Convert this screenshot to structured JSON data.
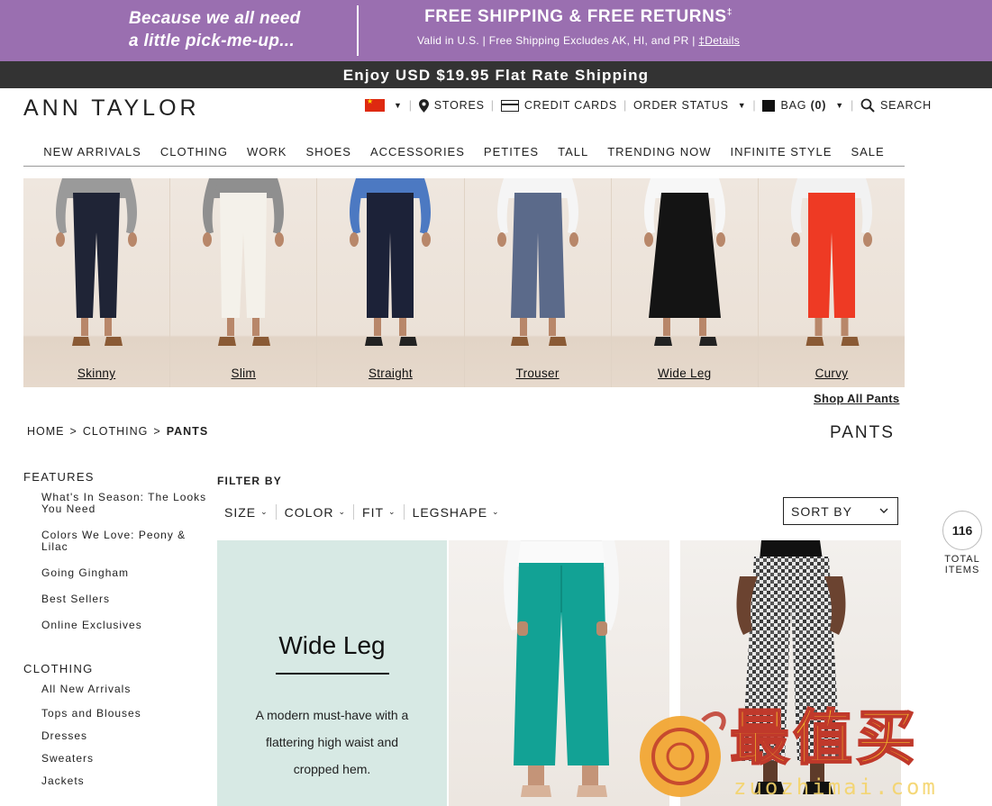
{
  "promo": {
    "left_line1": "Because we all need",
    "left_line2": "a little pick-me-up...",
    "headline": "FREE SHIPPING & FREE RETURNS",
    "headline_mark": "‡",
    "sub": "Valid in U.S. | Free Shipping Excludes AK, HI, and PR |",
    "details_link": "‡Details"
  },
  "shipbar": {
    "text": "Enjoy USD $19.95 Flat Rate Shipping"
  },
  "header": {
    "logo": "ANN TAYLOR",
    "stores": "STORES",
    "credit_cards": "CREDIT CARDS",
    "order_status": "ORDER STATUS",
    "bag": "BAG",
    "bag_count": "(0)",
    "search": "SEARCH"
  },
  "nav": {
    "items": [
      "NEW ARRIVALS",
      "CLOTHING",
      "WORK",
      "SHOES",
      "ACCESSORIES",
      "PETITES",
      "TALL",
      "TRENDING NOW",
      "INFINITE STYLE",
      "SALE"
    ]
  },
  "hero": {
    "tiles": [
      {
        "label": "Skinny",
        "pant": "#1f2436",
        "top": "#9a9a9a",
        "shape": "skinny"
      },
      {
        "label": "Slim",
        "pant": "#f4f1ea",
        "top": "#8f8f8f",
        "shape": "slim"
      },
      {
        "label": "Straight",
        "pant": "#1c2238",
        "top": "#4c79c2",
        "shape": "straight"
      },
      {
        "label": "Trouser",
        "pant": "#5b6a8a",
        "top": "#f5f5f5",
        "shape": "trouser"
      },
      {
        "label": "Wide Leg",
        "pant": "#141414",
        "top": "#f7f7f7",
        "shape": "wide"
      },
      {
        "label": "Curvy",
        "pant": "#ee3a24",
        "top": "#f2f2f2",
        "shape": "curvy"
      }
    ],
    "shop_all": "Shop All Pants"
  },
  "breadcrumb": {
    "home": "HOME",
    "sep": ">",
    "clothing": "CLOTHING",
    "current": "PANTS"
  },
  "page_title": "PANTS",
  "sidebar": {
    "features_heading": "FEATURES",
    "features": [
      "What's In Season: The Looks You Need",
      "Colors We Love: Peony & Lilac",
      "Going Gingham",
      "Best Sellers",
      "Online Exclusives"
    ],
    "clothing_heading": "CLOTHING",
    "clothing": [
      "All New Arrivals",
      "Tops and Blouses",
      "Dresses",
      "Sweaters",
      "Jackets"
    ]
  },
  "filters": {
    "label": "FILTER BY",
    "items": [
      "SIZE",
      "COLOR",
      "FIT",
      "LEGSHAPE"
    ],
    "sort_label": "SORT BY"
  },
  "total": {
    "count": "116",
    "line1": "TOTAL",
    "line2": "ITEMS"
  },
  "promo_card": {
    "title": "Wide Leg",
    "desc": "A modern must-have with a flattering high waist and cropped hem."
  },
  "watermark": {
    "brand": "值",
    "brand_b": "最",
    "brand_c": "买",
    "domain": "zuozhimai.com"
  },
  "colors": {
    "promo_bg": "#9a6fb0",
    "ship_bg": "#333333",
    "card_bg": "#d7e9e4"
  }
}
